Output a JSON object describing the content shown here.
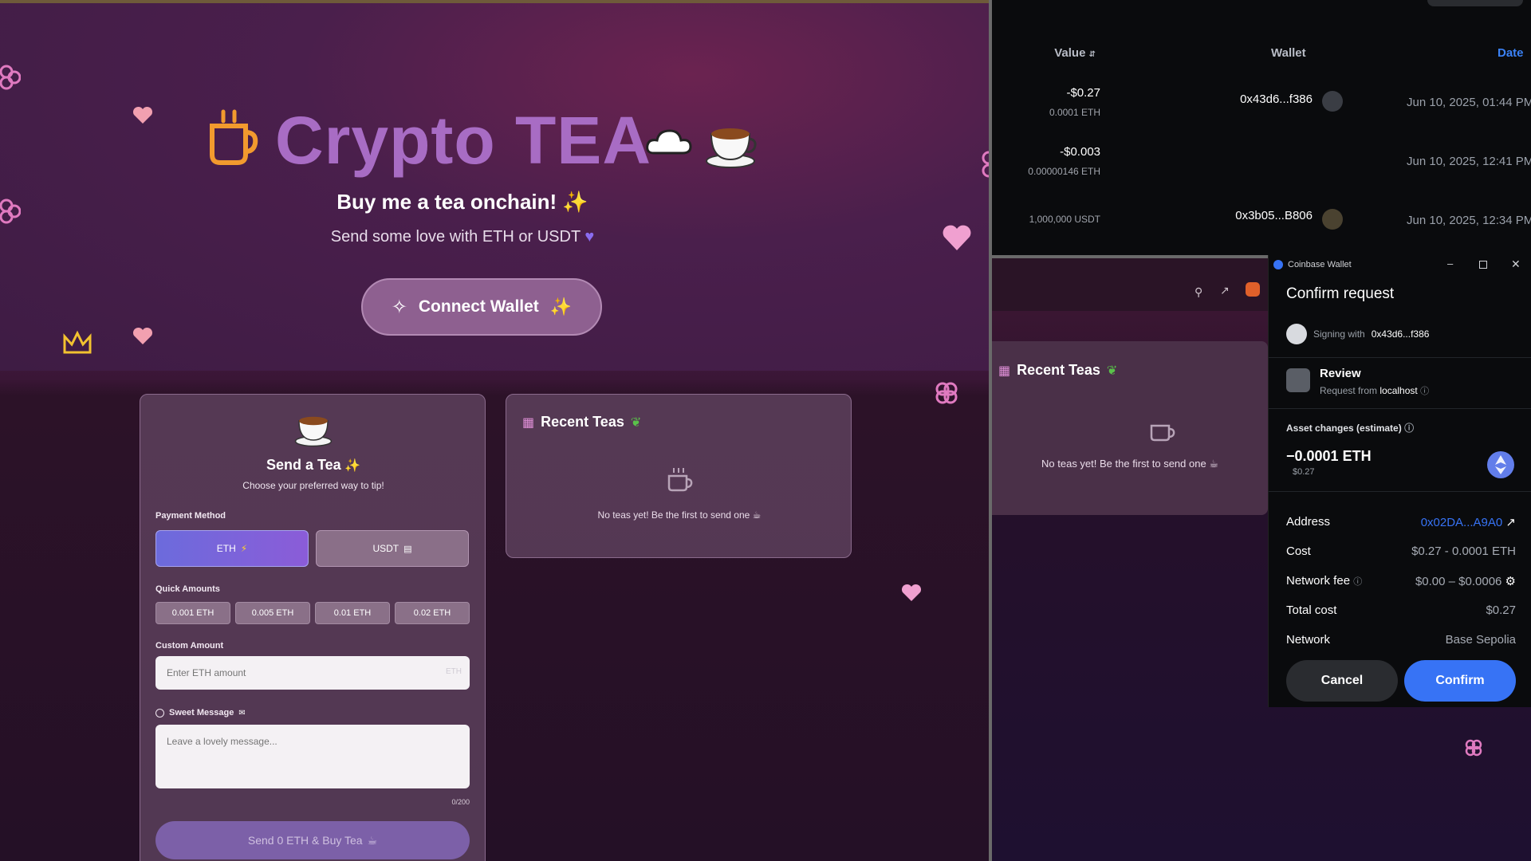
{
  "app": {
    "title": "Crypto TEA",
    "tagline": "Buy me a tea onchain!",
    "subline": "Send some love with ETH or USDT",
    "connect_label": "Connect Wallet"
  },
  "send_card": {
    "title": "Send a Tea",
    "subtitle": "Choose your preferred way to tip!",
    "payment_label": "Payment Method",
    "methods": [
      "ETH",
      "USDT"
    ],
    "quick_label": "Quick Amounts",
    "quick_amounts": [
      "0.001 ETH",
      "0.005 ETH",
      "0.01 ETH",
      "0.02 ETH"
    ],
    "custom_label": "Custom Amount",
    "amount_placeholder": "Enter ETH amount",
    "amount_suffix": "ETH",
    "message_label": "Sweet Message",
    "message_placeholder": "Leave a lovely message...",
    "char_count": "0/200",
    "send_label": "Send 0 ETH & Buy Tea"
  },
  "recent": {
    "title": "Recent Teas",
    "empty": "No teas yet! Be the first to send one"
  },
  "tx_table": {
    "headers": {
      "value": "Value",
      "wallet": "Wallet",
      "date": "Date"
    },
    "rows": [
      {
        "value": "-$0.27",
        "sub": "0.0001 ETH",
        "wallet": "0x43d6...f386",
        "date": "Jun 10, 2025, 01:44 PM"
      },
      {
        "value": "-$0.003",
        "sub": "0.00000146 ETH",
        "wallet": "",
        "date": "Jun 10, 2025, 12:41 PM"
      },
      {
        "value": "",
        "sub": "1,000,000 USDT",
        "wallet": "0x3b05...B806",
        "date": "Jun 10, 2025, 12:34 PM"
      }
    ]
  },
  "wallet": {
    "window_title": "Coinbase Wallet",
    "heading": "Confirm request",
    "signing_prefix": "Signing with",
    "signing_addr": "0x43d6...f386",
    "review": "Review",
    "request_from_prefix": "Request from",
    "request_from": "localhost",
    "asset_changes": "Asset changes (estimate)",
    "amount": "−0.0001 ETH",
    "amount_usd": "$0.27",
    "rows": [
      {
        "k": "Address",
        "v": "0x02DA...A9A0"
      },
      {
        "k": "Cost",
        "v": "$0.27 - 0.0001 ETH"
      },
      {
        "k": "Network fee",
        "v": "$0.00 – $0.0006"
      },
      {
        "k": "Total cost",
        "v": "$0.27"
      },
      {
        "k": "Network",
        "v": "Base Sepolia"
      }
    ],
    "cancel": "Cancel",
    "confirm": "Confirm",
    "accent": "#3773f5"
  }
}
